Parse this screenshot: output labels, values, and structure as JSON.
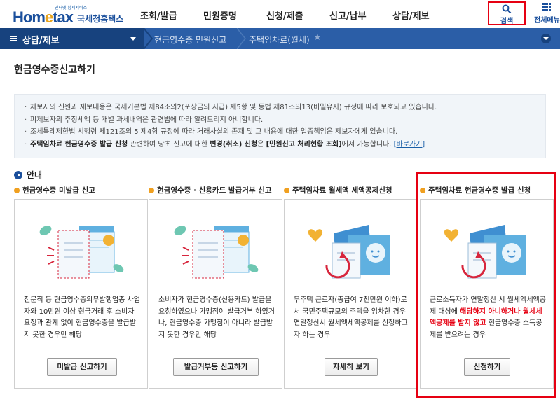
{
  "header": {
    "logo_tag": "인터넷 납세서비스",
    "logo_prefix": "Hom",
    "logo_e": "e",
    "logo_suffix": "tax",
    "logo_sub": "국세청홈택스",
    "menu": [
      "조회/발급",
      "민원증명",
      "신청/제출",
      "신고/납부",
      "상담/제보"
    ],
    "search_label": "검색",
    "allmenu_label": "전체메뉴"
  },
  "nav": {
    "first": "상담/제보",
    "crumbs": [
      "현금영수증 민원신고",
      "주택임차료(월세)"
    ]
  },
  "page": {
    "title": "현금영수증신고하기"
  },
  "notice": {
    "lines": [
      "제보자의 신원과 제보내용은 국세기본법 제84조의2(포상금의 지급) 제5항 및 동법 제81조의13(비밀유지) 규정에 따라 보호되고 있습니다.",
      "피제보자의 추징세액 등 개별 과세내역은 관련법에 따라 알려드리지 아니합니다.",
      "조세특례제한법 시행령 제121조의 5 제4항 규정에 따라 거래사실의 존재 및 그 내용에 대한 입증책임은 제보자에게 있습니다."
    ],
    "last_b1": "주택임차료 현금영수증 발급 신청",
    "last_t1": " 관련하여 당초 신고에 대한 ",
    "last_b2": "변경(취소) 신청",
    "last_t2": "은 ",
    "last_b3": "[민원신고 처리현황 조회]",
    "last_t3": "에서 가능합니다. ",
    "last_link": "[바로가기]"
  },
  "info": {
    "heading": "안내"
  },
  "cards": [
    {
      "title": "현금영수증 미발급 신고",
      "desc": "전문직 등 현금영수증의무발행업종 사업자와 10만원 이상 현금거래 후 소비자 요청과 관계 없이 현금영수증을 발급받지 못한 경우만 해당",
      "button": "미발급 신고하기"
    },
    {
      "title": "현금영수증 · 신용카드 발급거부 신고",
      "desc": "소비자가 현금영수증(신용카드) 발급을 요청하였으나 가맹점이 발급거부 하였거나, 현금영수증 가맹점이 아니라 발급받지 못한 경우만 해당",
      "button": "발급거부등 신고하기"
    },
    {
      "title": "주택임차료 월세액 세액공제신청",
      "desc": "무주택 근로자(총급여 7천만원 이하)로서 국민주택규모의 주택을 임차한 경우 연말정산시 월세액세액공제를 신청하고자 하는 경우",
      "button": "자세히 보기"
    },
    {
      "title": "주택임차료 현금영수증 발급 신청",
      "desc_pre": "근로소득자가 연말정산 시 월세액세액공제 대상에 ",
      "desc_red": "해당하지 아니하거나 월세세액공제를 받지 않고",
      "desc_post": " 현금영수증 소득공제를 받으려는 경우",
      "button": "신청하기"
    }
  ],
  "colors": {
    "brand": "#1a4f9c",
    "nav": "#2b5ea7",
    "nav_dark": "#17427e",
    "highlight": "#e60012",
    "bullet": "#f0a020"
  }
}
